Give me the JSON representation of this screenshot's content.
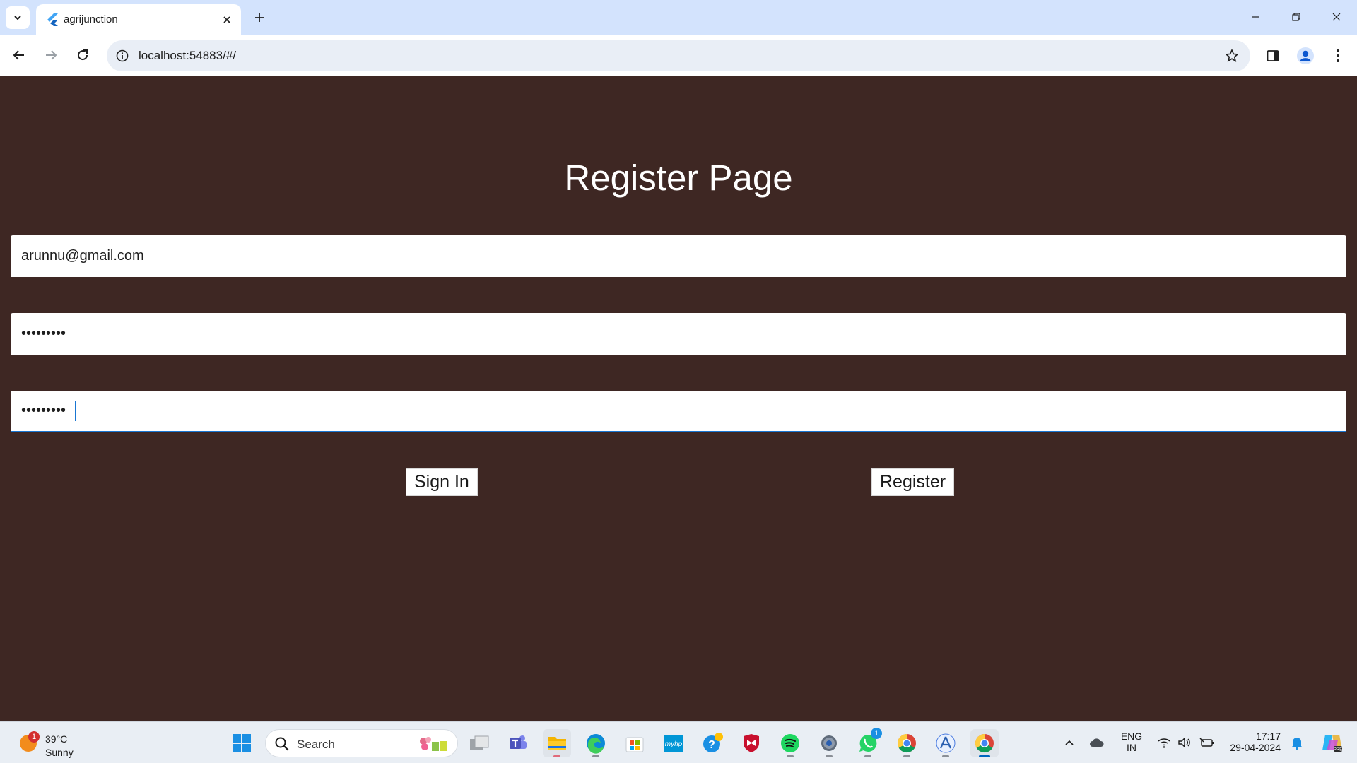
{
  "browser": {
    "tab_title": "agrijunction",
    "url": "localhost:54883/#/",
    "icons": {
      "tab_list": "chevron-down-icon",
      "favicon": "flutter-icon",
      "tab_close": "close-icon",
      "new_tab": "plus-icon",
      "minimize": "minimize-icon",
      "restore": "restore-icon",
      "close_window": "close-icon",
      "back": "back-arrow-icon",
      "forward": "forward-arrow-icon",
      "reload": "reload-icon",
      "site_info": "info-icon",
      "bookmark": "star-icon",
      "side_panel": "side-panel-icon",
      "profile": "profile-icon",
      "menu": "kebab-menu-icon"
    }
  },
  "page": {
    "title": "Register Page",
    "fields": {
      "email": "arunnu@gmail.com",
      "password": "•••••••••",
      "confirm_password": "•••••••••"
    },
    "buttons": {
      "sign_in": "Sign In",
      "register": "Register"
    },
    "colors": {
      "background": "#3e2723",
      "focus": "#1976d2"
    }
  },
  "taskbar": {
    "weather": {
      "temperature": "39°C",
      "condition": "Sunny",
      "badge": "1"
    },
    "search_placeholder": "Search",
    "apps": [
      {
        "name": "start-icon"
      },
      {
        "name": "task-view-icon"
      },
      {
        "name": "teams-icon"
      },
      {
        "name": "file-explorer-icon"
      },
      {
        "name": "edge-icon"
      },
      {
        "name": "store-icon"
      },
      {
        "name": "myhp-icon"
      },
      {
        "name": "get-help-icon"
      },
      {
        "name": "mcafee-icon"
      },
      {
        "name": "spotify-icon"
      },
      {
        "name": "settings-icon"
      },
      {
        "name": "whatsapp-icon",
        "badge": "1"
      },
      {
        "name": "chrome-icon"
      },
      {
        "name": "app-icon"
      },
      {
        "name": "chrome-active-icon"
      }
    ],
    "tray": {
      "language_line1": "ENG",
      "language_line2": "IN",
      "time": "17:17",
      "date": "29-04-2024"
    }
  }
}
